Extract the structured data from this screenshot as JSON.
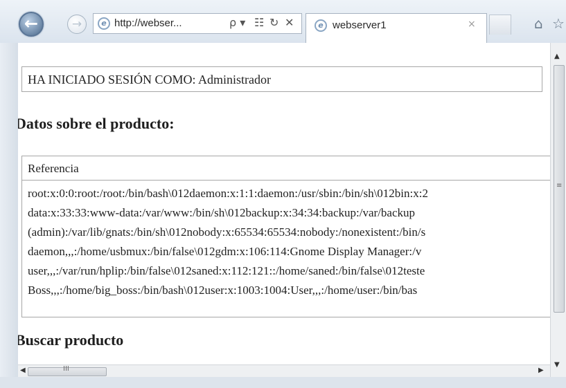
{
  "browser": {
    "address_url": "http://webser...",
    "address_tools": {
      "search": "ρ ▾",
      "compat": "☷",
      "refresh": "↻",
      "stop": "✕"
    },
    "tab_title": "webserver1",
    "tab_close": "×",
    "back_glyph": "←",
    "forward_glyph": "→",
    "home_icon": "⌂",
    "favorites_icon": "☆",
    "ie_icon_glyph": "e"
  },
  "page": {
    "login_status": "HA INICIADO SESIÓN COMO: Administrador",
    "product_heading": "Datos sobre el producto:",
    "table_header": "Referencia",
    "passwd_lines": [
      "root:x:0:0:root:/root:/bin/bash\\012daemon:x:1:1:daemon:/usr/sbin:/bin/sh\\012bin:x:2",
      "data:x:33:33:www-data:/var/www:/bin/sh\\012backup:x:34:34:backup:/var/backup",
      "(admin):/var/lib/gnats:/bin/sh\\012nobody:x:65534:65534:nobody:/nonexistent:/bin/s",
      "daemon,,,:/home/usbmux:/bin/false\\012gdm:x:106:114:Gnome Display Manager:/v",
      "user,,,:/var/run/hplip:/bin/false\\012saned:x:112:121::/home/saned:/bin/false\\012teste",
      "Boss,,,:/home/big_boss:/bin/bash\\012user:x:1003:1004:User,,,:/home/user:/bin/bas"
    ],
    "search_heading": "Buscar producto"
  },
  "scrollbars": {
    "up_arrow": "▲",
    "down_arrow": "▼",
    "left_arrow": "◀",
    "right_arrow": "▶",
    "v_grip": "≡",
    "h_grip": "III"
  }
}
